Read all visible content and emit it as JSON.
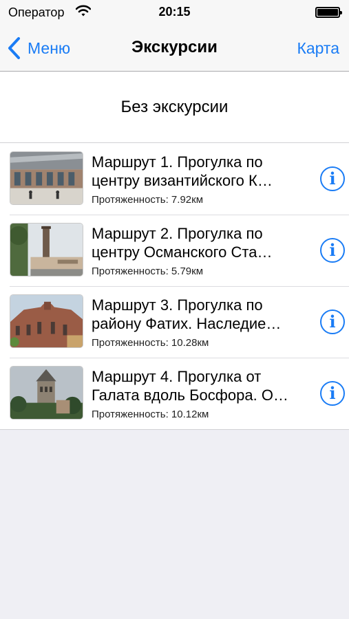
{
  "status": {
    "carrier": "Оператор",
    "time": "20:15"
  },
  "nav": {
    "back_label": "Меню",
    "title": "Экскурсии",
    "right_label": "Карта"
  },
  "no_tour_label": "Без экскурсии",
  "info_glyph": "i",
  "routes": [
    {
      "line1": "Маршрут 1. Прогулка по",
      "line2": "центру византийского К…",
      "length": "Протяженность: 7.92км",
      "thumbnail": "train-station-photo"
    },
    {
      "line1": "Маршрут 2. Прогулка по",
      "line2": "центру Османского Ста…",
      "length": "Протяженность: 5.79км",
      "thumbnail": "column-photo"
    },
    {
      "line1": "Маршрут 3. Прогулка по",
      "line2": "району Фатих. Наследие…",
      "length": "Протяженность: 10.28км",
      "thumbnail": "church-photo"
    },
    {
      "line1": "Маршрут 4. Прогулка от",
      "line2": "Галата вдоль Босфора. О…",
      "length": "Протяженность: 10.12км",
      "thumbnail": "galata-tower-photo"
    }
  ],
  "colors": {
    "accent": "#1a7cf5",
    "bar": "#f7f7f7",
    "background": "#efeff4"
  }
}
